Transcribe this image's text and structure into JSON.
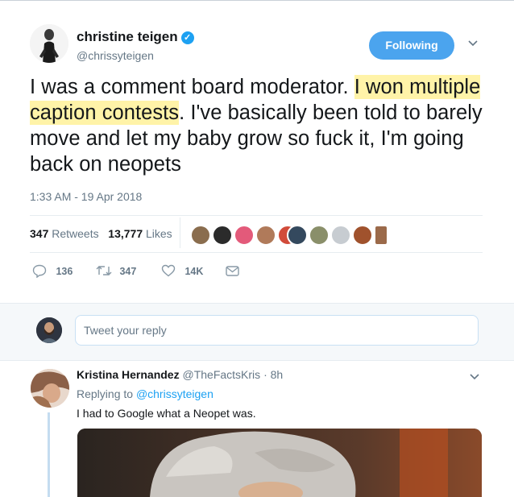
{
  "tweet": {
    "author_name": "christine teigen",
    "author_handle": "@chrissyteigen",
    "follow_label": "Following",
    "text_part1": "I was a comment board moderator. ",
    "text_highlight": "I won multiple caption contests",
    "text_part2": ". I've basically been told to barely move and let my baby grow so fuck it, I'm going back on neopets",
    "timestamp": "1:33 AM - 19 Apr 2018",
    "retweets_count": "347",
    "retweets_label": "Retweets",
    "likes_count": "13,777",
    "likes_label": "Likes",
    "actions": {
      "replies": "136",
      "retweets": "347",
      "likes": "14K"
    }
  },
  "reply_box": {
    "placeholder": "Tweet your reply"
  },
  "reply": {
    "author_name": "Kristina Hernandez",
    "author_handle": "@TheFactsKris",
    "time": "8h",
    "replying_prefix": "Replying to",
    "replying_to": "@chrissyteigen",
    "text": "I had to Google what a Neopet was."
  },
  "colors": {
    "accent": "#1da1f2",
    "follow_button": "#4ba4ee",
    "highlight": "#fff3a8",
    "muted": "#657786"
  }
}
